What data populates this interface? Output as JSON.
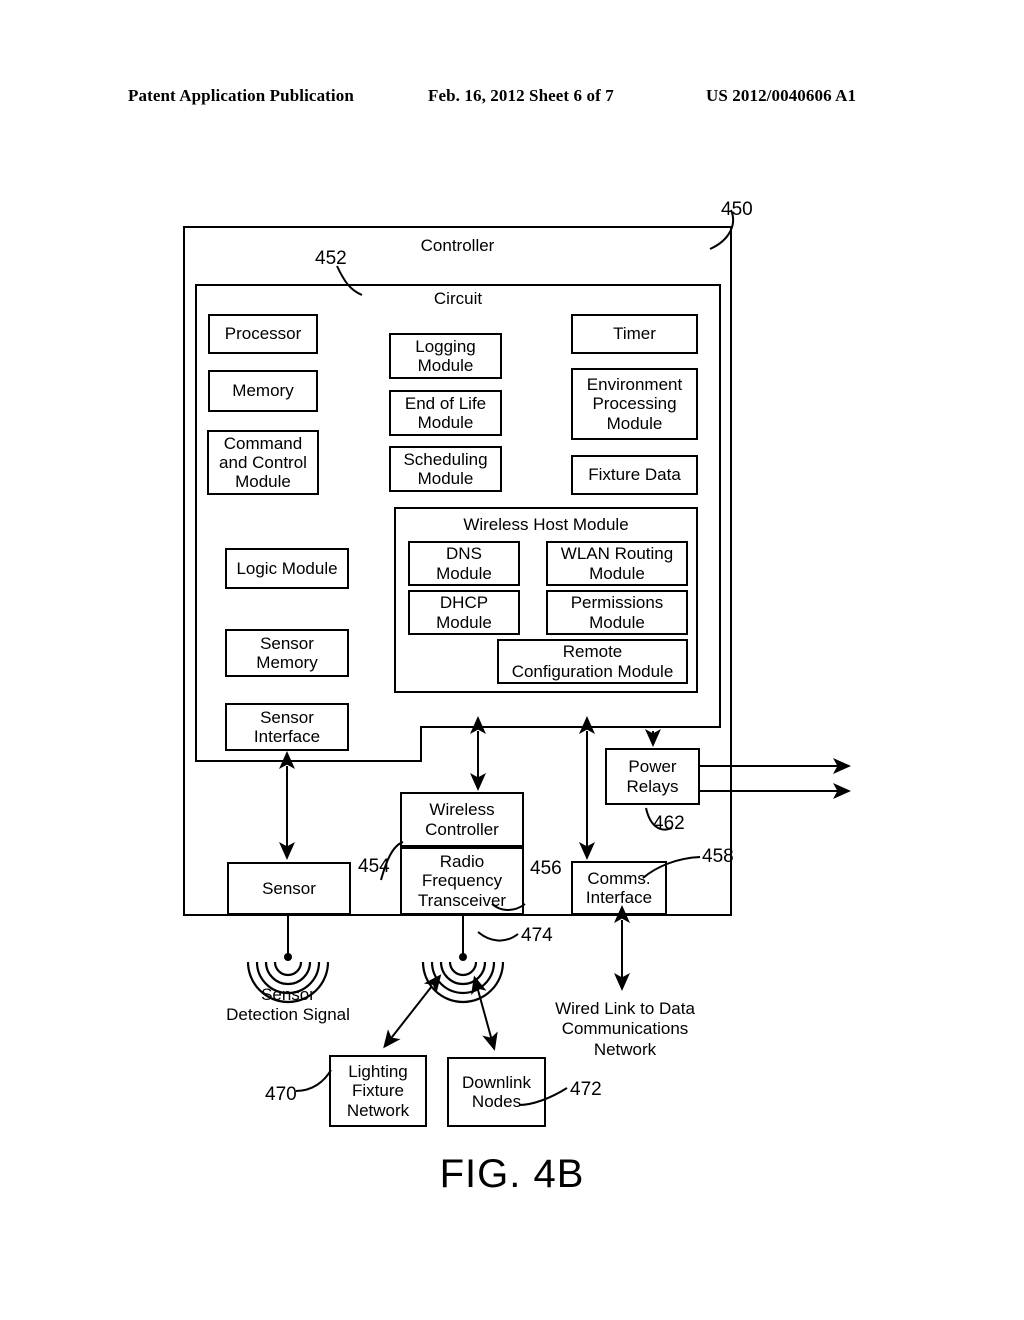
{
  "header": {
    "left": "Patent Application Publication",
    "middle": "Feb. 16, 2012  Sheet 6 of 7",
    "right": "US 2012/0040606 A1"
  },
  "figure": {
    "caption": "FIG. 4B"
  },
  "controller": {
    "title": "Controller",
    "ref": "450"
  },
  "circuit": {
    "title": "Circuit",
    "ref": "452"
  },
  "left_column": [
    {
      "label": "Processor"
    },
    {
      "label": "Memory"
    },
    {
      "label": "Command\nand Control\nModule"
    }
  ],
  "left_lower_column": [
    {
      "label": "Logic Module"
    },
    {
      "label": "Sensor\nMemory"
    },
    {
      "label": "Sensor\nInterface"
    }
  ],
  "middle_column": [
    {
      "label": "Logging\nModule"
    },
    {
      "label": "End of Life\nModule"
    },
    {
      "label": "Scheduling\nModule"
    }
  ],
  "right_column": [
    {
      "label": "Timer"
    },
    {
      "label": "Environment\nProcessing\nModule"
    },
    {
      "label": "Fixture Data"
    }
  ],
  "wireless_host_module": {
    "title": "Wireless Host Module",
    "children": [
      {
        "label": "DNS\nModule"
      },
      {
        "label": "WLAN Routing\nModule"
      },
      {
        "label": "DHCP\nModule"
      },
      {
        "label": "Permissions\nModule"
      },
      {
        "label": "Remote\nConfiguration Module"
      }
    ]
  },
  "hardware": {
    "sensor": {
      "label": "Sensor"
    },
    "wireless_controller": {
      "label": "Wireless\nController",
      "ref": "454"
    },
    "radio_frequency_transceiver": {
      "label": "Radio\nFrequency\nTransceiver",
      "ref": "456"
    },
    "power_relays": {
      "label": "Power\nRelays",
      "ref": "462"
    },
    "comms_interface": {
      "label": "Comms.\nInterface",
      "ref": "458"
    }
  },
  "external": {
    "sensor_detection_signal": {
      "label": "Sensor\nDetection Signal"
    },
    "antenna_rf": {
      "ref": "474"
    },
    "lighting_fixture_network": {
      "label": "Lighting\nFixture\nNetwork",
      "ref": "470"
    },
    "downlink_nodes": {
      "label": "Downlink\nNodes",
      "ref": "472"
    },
    "wired_link": {
      "label": "Wired Link to Data\nCommunications\nNetwork"
    }
  },
  "colors": {
    "line": "#000000",
    "background": "#ffffff"
  }
}
